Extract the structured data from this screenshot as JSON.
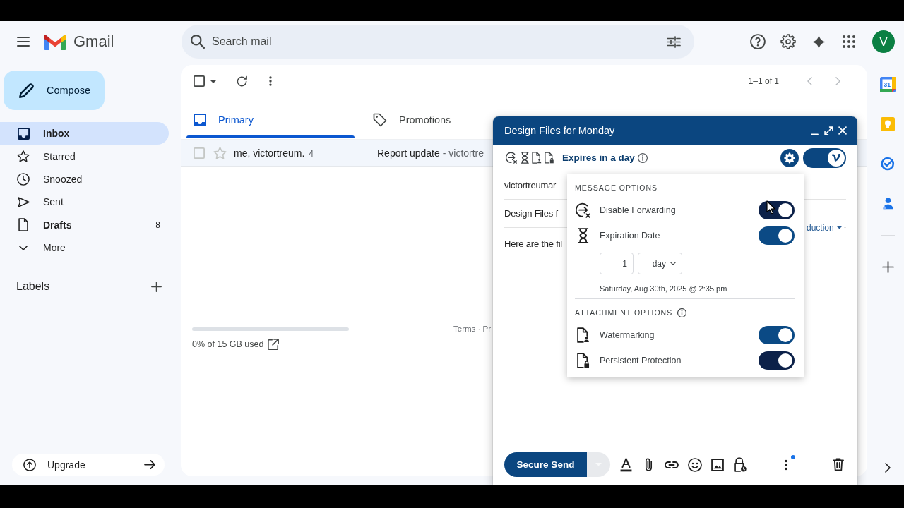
{
  "header": {
    "app_name": "Gmail",
    "search": {
      "placeholder": "Search mail"
    },
    "avatar": {
      "initial": "V"
    }
  },
  "sidebar": {
    "compose": "Compose",
    "items": [
      {
        "label": "Inbox",
        "selected": true,
        "unread": true
      },
      {
        "label": "Starred",
        "selected": false,
        "unread": false
      },
      {
        "label": "Snoozed",
        "selected": false,
        "unread": false
      },
      {
        "label": "Sent",
        "selected": false,
        "unread": false
      },
      {
        "label": "Drafts",
        "selected": false,
        "unread": true,
        "count": "8"
      },
      {
        "label": "More",
        "selected": false,
        "unread": false
      }
    ],
    "labels": {
      "heading": "Labels"
    },
    "upgrade": "Upgrade"
  },
  "mail_list": {
    "page_range": "1–1 of 1",
    "tabs": [
      {
        "label": "Primary",
        "selected": true
      },
      {
        "label": "Promotions",
        "selected": false
      }
    ],
    "rows": [
      {
        "sender": "me, victortreum.",
        "count": "4",
        "subject": "Report update",
        "snippet": "- victortre",
        "checked": false,
        "starred": false
      }
    ],
    "storage": "0% of 15 GB used",
    "footer_links": "Terms · Pr"
  },
  "side_panel": {
    "calendar_date": "31"
  },
  "compose": {
    "title": "Design Files for Monday",
    "protections_status": "Expires in a day",
    "protection_enabled": true,
    "to": "victortreumar",
    "subject": "Design Files f",
    "body": "Here are the fil",
    "template_picker": "duction",
    "send_label": "Secure Send",
    "options_menu": {
      "sections": [
        {
          "heading": "MESSAGE OPTIONS",
          "has_info": false,
          "options": [
            {
              "label": "Disable Forwarding",
              "on": true,
              "color": "#0c2149"
            },
            {
              "label": "Expiration Date",
              "on": true,
              "color": "#0b4a85",
              "expiry": {
                "amount": "1",
                "unit": "day",
                "expires_at": "Saturday, Aug 30th, 2025 @ 2:35 pm"
              }
            }
          ]
        },
        {
          "heading": "ATTACHMENT OPTIONS",
          "has_info": true,
          "options": [
            {
              "label": "Watermarking",
              "on": true,
              "color": "#0b4a85"
            },
            {
              "label": "Persistent Protection",
              "on": true,
              "color": "#0c2149"
            }
          ]
        }
      ]
    }
  }
}
